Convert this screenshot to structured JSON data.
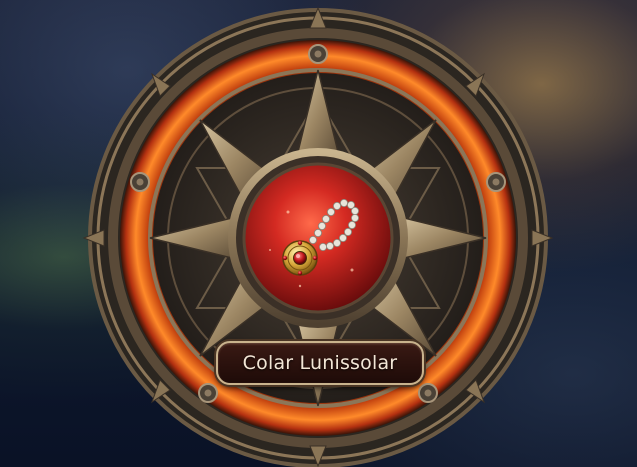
{
  "item": {
    "name": "Colar Lunissolar",
    "icon": "amulet-necklace-icon"
  },
  "colors": {
    "frame_bronze": "#8a7556",
    "frame_dark": "#2a2520",
    "fire_ring": "#d2461a",
    "medallion_red": "#b21f1a",
    "plate_text": "#f3e6d6"
  }
}
